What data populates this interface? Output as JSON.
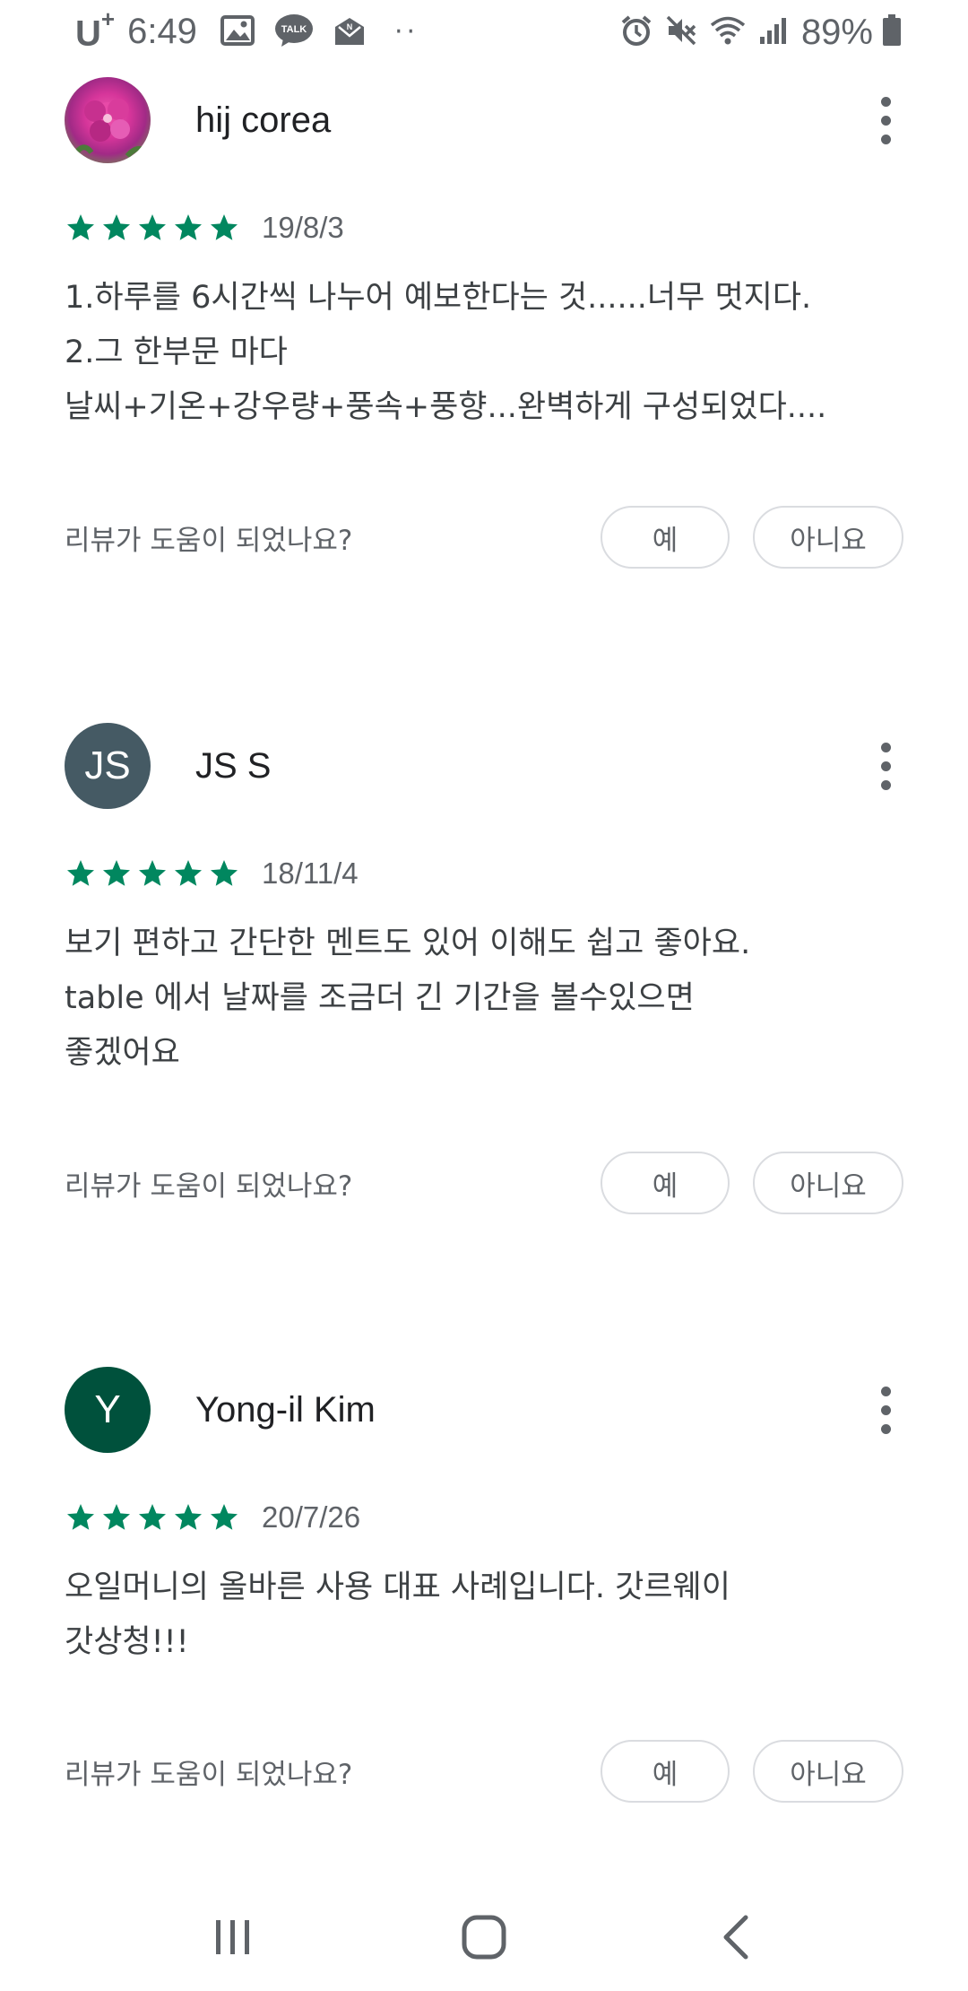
{
  "status_bar": {
    "carrier": "U",
    "carrier_plus": "+",
    "time": "6:49",
    "left_icons": [
      "image-icon",
      "kakaotalk-icon",
      "message-icon"
    ],
    "overflow_dots": "··",
    "right_icons": [
      "alarm-icon",
      "mute-icon",
      "wifi-icon",
      "signal-icon"
    ],
    "battery_percent": "89%"
  },
  "reviews": [
    {
      "author": "hij corea",
      "avatar_type": "photo",
      "avatar_initials": "",
      "rating": 5,
      "date": "19/8/3",
      "text": "1.하루를 6시간씩 나누어 예보한다는 것......너무 멋지다.\n2.그 한부문 마다\n날씨+기온+강우량+풍속+풍향...완벽하게 구성되었다....",
      "helpful_question": "리뷰가 도움이 되었나요?",
      "yes_label": "예",
      "no_label": "아니요"
    },
    {
      "author": "JS S",
      "avatar_type": "initials",
      "avatar_initials": "JS",
      "avatar_color": "#455a64",
      "rating": 5,
      "date": "18/11/4",
      "text": "보기 편하고 간단한 멘트도 있어 이해도 쉽고 좋아요.\ntable 에서 날짜를 조금더 긴 기간을 볼수있으면\n좋겠어요",
      "helpful_question": "리뷰가 도움이 되었나요?",
      "yes_label": "예",
      "no_label": "아니요"
    },
    {
      "author": "Yong-il Kim",
      "avatar_type": "initials",
      "avatar_initials": "Y",
      "avatar_color": "#00513c",
      "rating": 5,
      "date": "20/7/26",
      "text": "오일머니의 올바른 사용 대표 사례입니다. 갓르웨이\n갓상청!!!",
      "helpful_question": "리뷰가 도움이 되었나요?",
      "yes_label": "예",
      "no_label": "아니요"
    }
  ],
  "colors": {
    "star": "#01875f",
    "text_primary": "#202124",
    "text_secondary": "#5f6368",
    "pill_border": "#dadce0"
  },
  "nav_bar": {
    "buttons": [
      "recents-icon",
      "home-icon",
      "back-icon"
    ]
  }
}
